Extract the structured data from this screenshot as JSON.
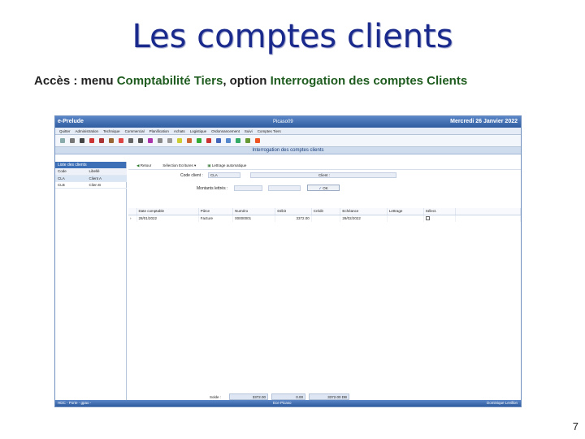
{
  "slide": {
    "title": "Les comptes clients",
    "subtitle_prefix": "Accès : menu ",
    "subtitle_menu": "Comptabilité Tiers",
    "subtitle_mid": ", option ",
    "subtitle_option": "Interrogation des comptes Clients",
    "page_number": "7"
  },
  "app": {
    "name": "e-Prelude",
    "company": "Picaso09",
    "date": "Mercredi 26 Janvier 2022",
    "menu": [
      "Quitter",
      "Administration",
      "Technique",
      "Commercial",
      "Planification",
      "Achats",
      "Logistique",
      "Ordonnancement",
      "Suivi",
      "Comptes Tiers"
    ],
    "module_title": "Interrogation des comptes clients",
    "left_pane": {
      "title": "Liste des clients",
      "headers": [
        "Code",
        "Libellé"
      ],
      "rows": [
        {
          "code": "CLA",
          "label": "Client A"
        },
        {
          "code": "CLB",
          "label": "Clien B"
        }
      ]
    },
    "actions": {
      "back": "Retour",
      "selection": "Sélection Ecritures",
      "lettrage": "Lettrage automatique"
    },
    "form": {
      "code_client_label": "Code client :",
      "code_client_value": "CLA",
      "client_label": "Client :",
      "client_value": "",
      "montants_label": "Montants lettrés :",
      "validate_label": "OK"
    },
    "grid": {
      "columns": [
        "Date comptable",
        "Pièce",
        "Numéro",
        "Débit",
        "Crédit",
        "Echéance",
        "Lettrage",
        "Sélect."
      ],
      "rows": [
        {
          "date": "28/01/2022",
          "piece": "Facture",
          "numero": "00000001",
          "debit": "3372.00",
          "credit": "",
          "echeance": "28/02/2022",
          "lettrage": ""
        }
      ]
    },
    "totals": {
      "label": "Solde :",
      "debit": "3372.00",
      "credit": "0.00",
      "solde": "3372.00 DB"
    },
    "status": {
      "left": "HDC - Porte - gpao -",
      "center": "Ece Picaso",
      "right": "Dominique Levillon"
    }
  }
}
